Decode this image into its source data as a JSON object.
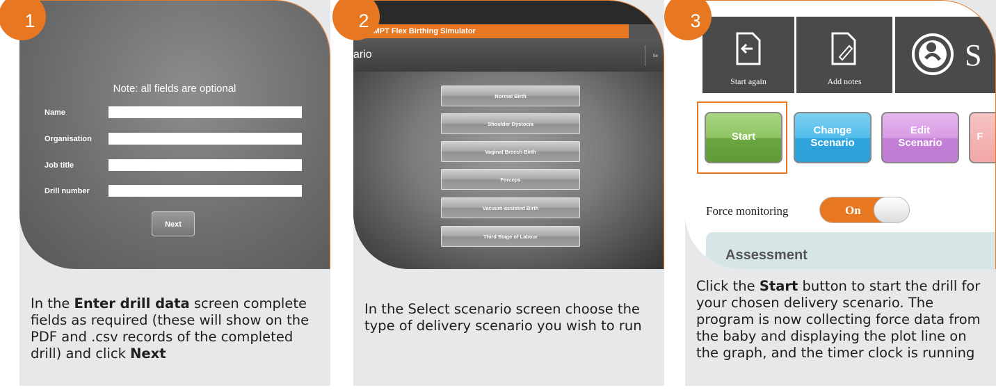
{
  "steps": [
    {
      "number": "1",
      "screen": {
        "note": "Note: all fields are optional",
        "fields": [
          "Name",
          "Organisation",
          "Job title",
          "Drill number"
        ],
        "next_button": "Next"
      },
      "caption": {
        "pre": "In the ",
        "bold1": "Enter drill data",
        "mid": " screen complete fields as required (these will show on the PDF and .csv records of the completed drill) and click ",
        "bold2": "Next"
      }
    },
    {
      "number": "2",
      "screen": {
        "app_title": "OMPT Flex Birthing Simulator",
        "header": "ario",
        "header_side": "Se",
        "scenarios": [
          "Normal Birth",
          "Shoulder Dystocia",
          "Vaginal Breech Birth",
          "Forceps",
          "Vacuum-assisted Birth",
          "Third Stage of Labour"
        ]
      },
      "caption": {
        "text": "In the Select scenario screen choose the type of delivery scenario you wish to run"
      }
    },
    {
      "number": "3",
      "screen": {
        "tiles": [
          "Start again",
          "Add notes"
        ],
        "tile_partial_letter": "S",
        "buttons": [
          "Start",
          "Change Scenario",
          "Edit Scenario",
          "F"
        ],
        "force_label": "Force monitoring",
        "toggle_state": "On",
        "section": "Assessment"
      },
      "caption": {
        "pre": "Click the ",
        "bold": "Start",
        "post": " button to start the drill for your chosen delivery scenario. The program is now collecting force data from the baby and displaying the plot line on the graph, and the timer clock is running"
      }
    }
  ],
  "colors": {
    "accent": "#e87722",
    "card_bg": "#e7e8e9",
    "start_green": "#7ab648",
    "change_blue": "#3fb4e6",
    "edit_purple": "#c98ad8"
  }
}
